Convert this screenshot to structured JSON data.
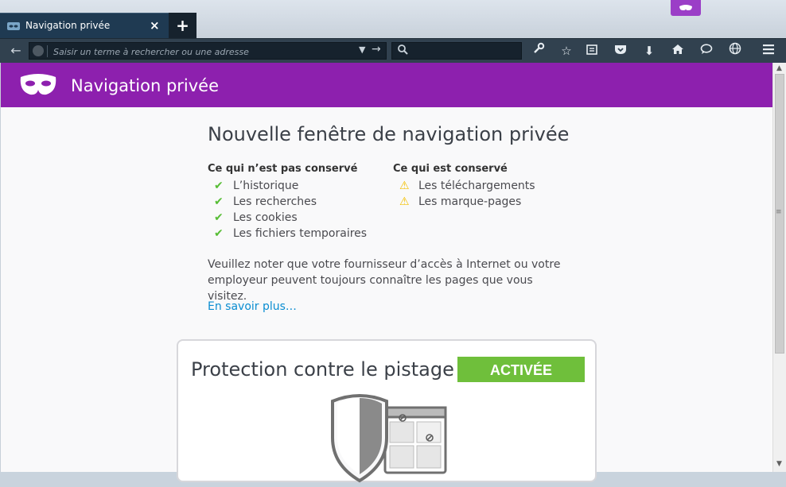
{
  "tab": {
    "title": "Navigation privée",
    "close": "×"
  },
  "newtab": {
    "label": "+"
  },
  "toolbar": {
    "back": "←",
    "url_placeholder": "Saisir un terme à rechercher ou une adresse",
    "dropdown": "▼",
    "go": "→",
    "search_icon": "search-icon"
  },
  "header": {
    "title": "Navigation privée"
  },
  "main": {
    "title": "Nouvelle fenêtre de navigation privée",
    "not_saved": {
      "heading": "Ce qui n’est pas conservé",
      "items": [
        "L’historique",
        "Les recherches",
        "Les cookies",
        "Les fichiers temporaires"
      ]
    },
    "saved": {
      "heading": "Ce qui est conservé",
      "items": [
        "Les téléchargements",
        "Les marque-pages"
      ]
    },
    "note": "Veuillez noter que votre fournisseur d’accès à Internet ou votre employeur peuvent toujours connaître les pages que vous visitez.",
    "learn_more": "En savoir plus…"
  },
  "tracking": {
    "title": "Protection contre le pistage",
    "status": "ACTIVÉE"
  },
  "colors": {
    "accent": "#8d20ae",
    "toolbar": "#31414f",
    "enabled": "#6fbf3b",
    "link": "#0a8dd1"
  }
}
